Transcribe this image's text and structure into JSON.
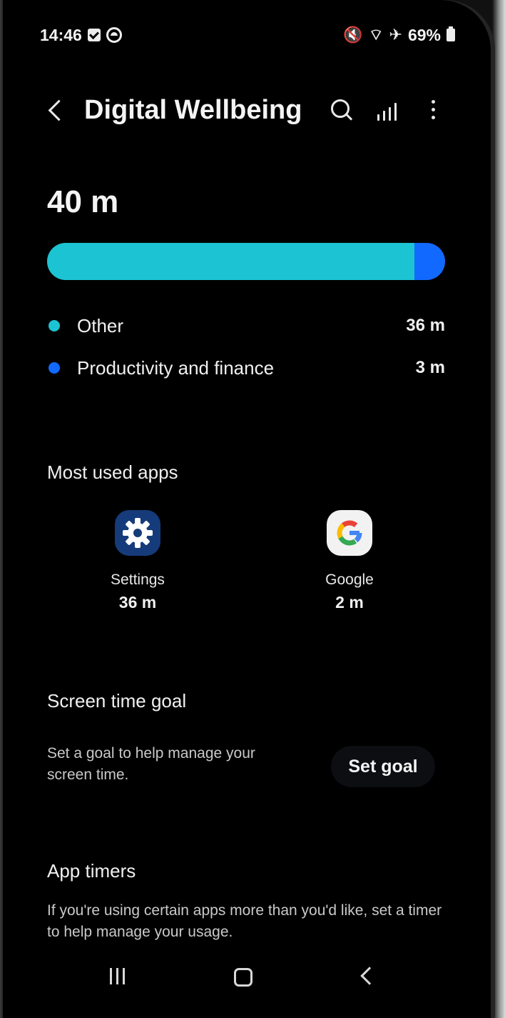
{
  "status_bar": {
    "time": "14:46",
    "battery": "69%",
    "left_icons": [
      "checkbox-notification-icon",
      "circle-notification-icon"
    ],
    "right_icons": [
      "mute-icon",
      "wifi-icon",
      "airplane-mode-icon",
      "battery-icon"
    ]
  },
  "header": {
    "title": "Digital Wellbeing",
    "actions": [
      "search-icon",
      "stats-icon",
      "more-options-icon"
    ]
  },
  "usage": {
    "total": "40 m",
    "categories": [
      {
        "label": "Other",
        "value": "36 m",
        "minutes": 36,
        "color": "#1cc3d2"
      },
      {
        "label": "Productivity and finance",
        "value": "3 m",
        "minutes": 3,
        "color": "#1269ff"
      }
    ]
  },
  "most_used": {
    "title": "Most used apps",
    "apps": [
      {
        "name": "Settings",
        "time": "36 m",
        "icon": "settings-gear-icon"
      },
      {
        "name": "Google",
        "time": "2 m",
        "icon": "google-g-icon"
      }
    ]
  },
  "screen_time_goal": {
    "title": "Screen time goal",
    "description": "Set a goal to help manage your screen time.",
    "button_label": "Set goal"
  },
  "app_timers": {
    "title": "App timers",
    "description": "If you're using certain apps more than you'd like, set a timer to help manage your usage."
  },
  "navigation": {
    "buttons": [
      "recent-apps-icon",
      "home-icon",
      "back-icon"
    ]
  },
  "colors": {
    "background": "#000000",
    "other": "#1cc3d2",
    "productivity": "#1269ff",
    "settings_icon": "#163b7a"
  }
}
